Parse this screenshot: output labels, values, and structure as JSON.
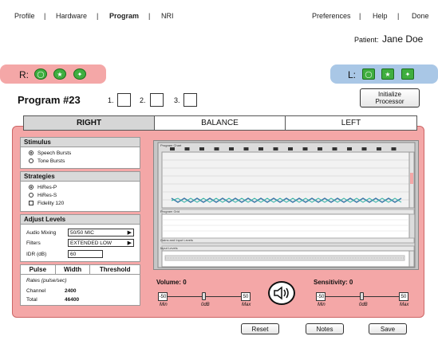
{
  "nav": {
    "left": [
      {
        "label": "Profile",
        "selected": false
      },
      {
        "label": "Hardware",
        "selected": false
      },
      {
        "label": "Program",
        "selected": true
      },
      {
        "label": "NRI",
        "selected": false
      }
    ],
    "right": [
      "Preferences",
      "Help",
      "Done"
    ]
  },
  "patient": {
    "label": "Patient:",
    "name": "Jane Doe"
  },
  "right_bar": {
    "label": "R:"
  },
  "left_bar": {
    "label": "L:"
  },
  "program": {
    "title": "Program #23",
    "slots": [
      "1.",
      "2.",
      "3."
    ],
    "initialize_label": "Initialize Processor"
  },
  "tabs": [
    {
      "label": "RIGHT",
      "selected": true
    },
    {
      "label": "BALANCE",
      "selected": false
    },
    {
      "label": "LEFT",
      "selected": false
    }
  ],
  "stimulus": {
    "title": "Stimulus",
    "options": [
      {
        "label": "Speech Bursts",
        "selected": true
      },
      {
        "label": "Tone Bursts",
        "selected": false
      }
    ]
  },
  "strategies": {
    "title": "Strategies",
    "options": [
      {
        "label": "HiRes-P",
        "selected": true
      },
      {
        "label": "HiRes-S",
        "selected": false
      }
    ],
    "checkbox": {
      "label": "Fidelity 120",
      "checked": false
    }
  },
  "adjust": {
    "title": "Adjust Levels",
    "audio_mixing_label": "Audio Mixing",
    "audio_mixing_value": "50/50 MIC",
    "filters_label": "Filters",
    "filters_value": "EXTENDED LOW",
    "idr_label": "IDR (dB)",
    "idr_value": "60"
  },
  "pulse": {
    "tabs": [
      "Pulse",
      "Width",
      "Threshold"
    ],
    "rates_label": "Rates (pulse/sec)",
    "channel_label": "Channel",
    "channel_value": "2400",
    "total_label": "Total",
    "total_value": "46400"
  },
  "chart": {
    "program_chart_label": "Program Chart",
    "program_grid_label": "Program Grid",
    "gains_label": "Gains and Input Levels",
    "input_levels_label": "Input Levels"
  },
  "volume": {
    "label": "Volume: 0",
    "min_box": "-50",
    "max_box": "50",
    "min_label": "Min",
    "mid_label": "0dB",
    "max_label": "Max",
    "value": 0
  },
  "sensitivity": {
    "label": "Sensitivity: 0",
    "min_box": "-50",
    "max_box": "50",
    "min_label": "Min",
    "mid_label": "0dB",
    "max_label": "Max",
    "value": 0
  },
  "footer": {
    "reset": "Reset",
    "notes": "Notes",
    "save": "Save"
  }
}
